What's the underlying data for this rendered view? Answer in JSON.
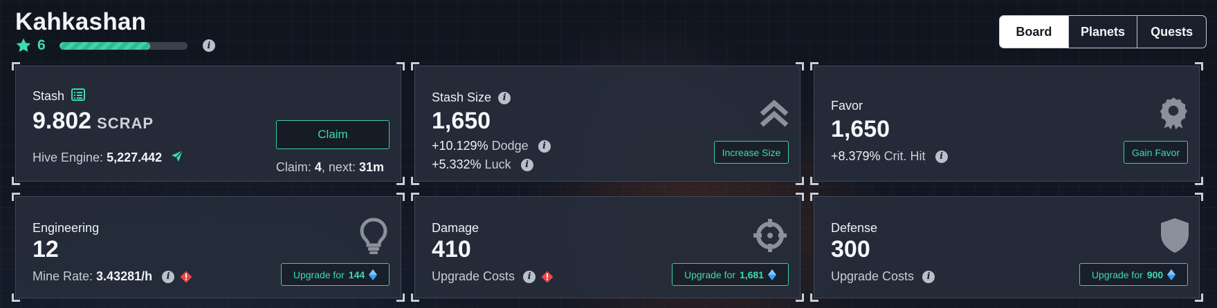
{
  "header": {
    "title": "Kahkashan",
    "level": "6",
    "xp_progress": 0.71
  },
  "tabs": [
    {
      "label": "Board",
      "active": true
    },
    {
      "label": "Planets",
      "active": false
    },
    {
      "label": "Quests",
      "active": false
    }
  ],
  "stash": {
    "title": "Stash",
    "value": "9.802",
    "unit": "SCRAP",
    "hive_label": "Hive Engine:",
    "hive_value": "5,227.442",
    "claim_button": "Claim",
    "claim_label": "Claim:",
    "claim_count": "4",
    "next_label": ", next:",
    "next_value": "31m"
  },
  "stash_size": {
    "title": "Stash Size",
    "value": "1,650",
    "dodge_value": "+10.129%",
    "dodge_label": "Dodge",
    "luck_value": "+5.332%",
    "luck_label": "Luck",
    "button": "Increase Size"
  },
  "favor": {
    "title": "Favor",
    "value": "1,650",
    "crit_value": "+8.379%",
    "crit_label": "Crit. Hit",
    "button": "Gain Favor"
  },
  "engineering": {
    "title": "Engineering",
    "value": "12",
    "rate_label": "Mine Rate:",
    "rate_value": "3.43281/h",
    "button_label": "Upgrade for",
    "button_cost": "144"
  },
  "damage": {
    "title": "Damage",
    "value": "410",
    "costs_label": "Upgrade Costs",
    "button_label": "Upgrade for",
    "button_cost": "1,681"
  },
  "defense": {
    "title": "Defense",
    "value": "300",
    "costs_label": "Upgrade Costs",
    "button_label": "Upgrade for",
    "button_cost": "900"
  },
  "colors": {
    "accent": "#3ddbae",
    "warning": "#e5484d",
    "card_bg": "#262c3a",
    "gem": "#3aa0ff"
  },
  "icons": {
    "level": "star-icon",
    "stash": "list-icon",
    "hive": "send-icon",
    "stash_size": "double-chevron-up-icon",
    "favor": "award-icon",
    "engineering": "lightbulb-icon",
    "damage": "crosshair-icon",
    "defense": "shield-icon",
    "cost": "gem-icon",
    "warning": "warning-icon",
    "info": "info-icon"
  }
}
